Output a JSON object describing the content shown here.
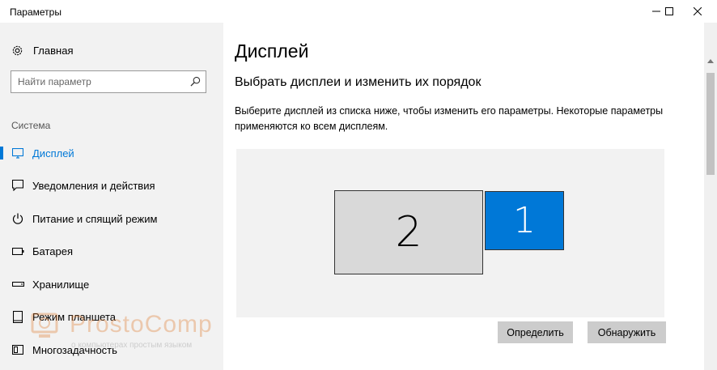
{
  "window": {
    "title": "Параметры",
    "minimize_icon": "minimize-icon",
    "maximize_icon": "maximize-icon",
    "close_icon": "close-icon"
  },
  "sidebar": {
    "home_label": "Главная",
    "home_icon": "gear-icon",
    "search": {
      "placeholder": "Найти параметр",
      "value": "",
      "icon": "search-icon"
    },
    "section_label": "Система",
    "items": [
      {
        "label": "Дисплей",
        "icon": "monitor-icon",
        "active": true
      },
      {
        "label": "Уведомления и действия",
        "icon": "notification-icon",
        "active": false
      },
      {
        "label": "Питание и спящий режим",
        "icon": "power-icon",
        "active": false
      },
      {
        "label": "Батарея",
        "icon": "battery-icon",
        "active": false
      },
      {
        "label": "Хранилище",
        "icon": "storage-icon",
        "active": false
      },
      {
        "label": "Режим планшета",
        "icon": "tablet-icon",
        "active": false
      },
      {
        "label": "Многозадачность",
        "icon": "multitasking-icon",
        "active": false
      }
    ]
  },
  "watermark": {
    "name": "ProstoComp",
    "tagline": "о компьютерах простым языком"
  },
  "main": {
    "title": "Дисплей",
    "subtitle": "Выбрать дисплеи и изменить их порядок",
    "description": "Выберите дисплей из списка ниже, чтобы изменить его параметры. Некоторые параметры применяются ко всем дисплеям.",
    "monitors": [
      {
        "number": "2",
        "selected": false
      },
      {
        "number": "1",
        "selected": true
      }
    ],
    "identify_label": "Определить",
    "detect_label": "Обнаружить"
  },
  "colors": {
    "accent": "#0078d7",
    "sidebar_bg": "#f2f2f2",
    "button_bg": "#cccccc",
    "monitor_unselected": "#d9d9d9"
  }
}
